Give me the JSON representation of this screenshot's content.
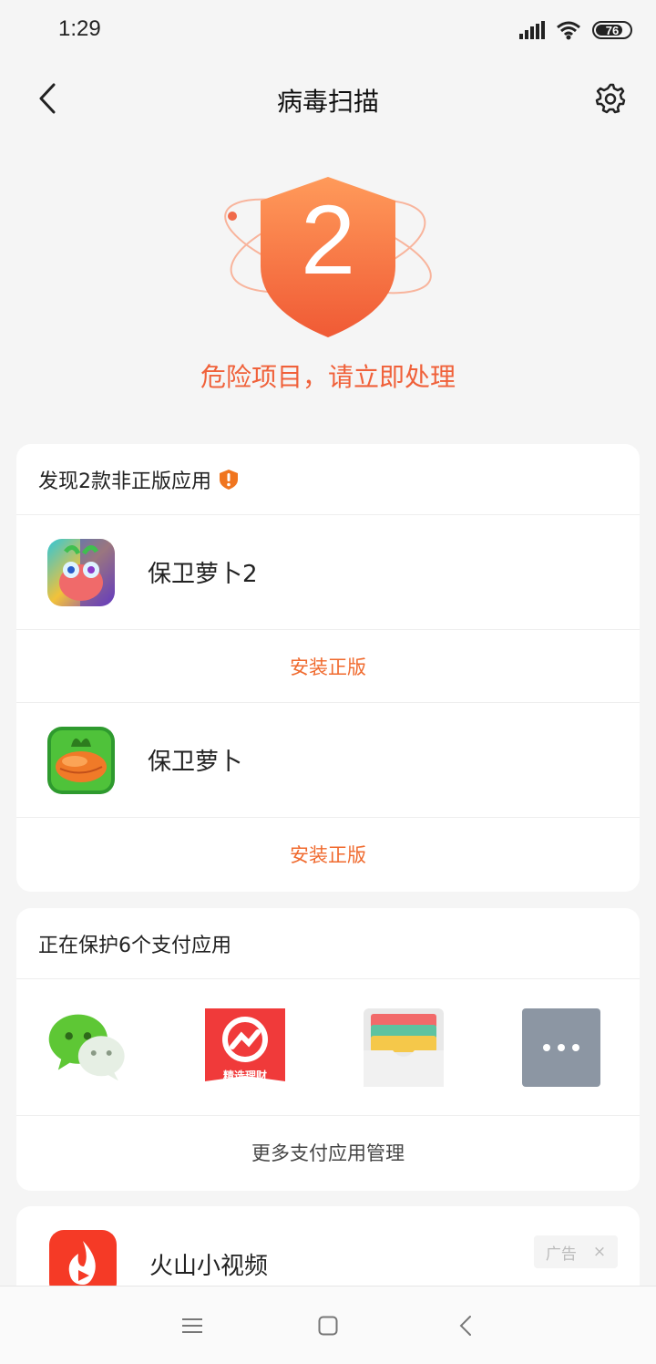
{
  "status_bar": {
    "time": "1:29",
    "battery": "76"
  },
  "header": {
    "title": "病毒扫描"
  },
  "hero": {
    "count": "2",
    "message": "危险项目，请立即处理"
  },
  "pirated_card": {
    "title": "发现2款非正版应用",
    "apps": [
      {
        "name": "保卫萝卜2",
        "action": "安装正版"
      },
      {
        "name": "保卫萝卜",
        "action": "安装正版"
      }
    ]
  },
  "payment_card": {
    "title": "正在保护6个支付应用",
    "icons": [
      "wechat-icon",
      "finance-app-icon",
      "wallet-icon",
      "more-icon"
    ],
    "finance_icon_text": "精选理财",
    "manage_label": "更多支付应用管理"
  },
  "ad_card": {
    "app_name": "火山小视频",
    "ad_label": "广告",
    "close_glyph": "×"
  },
  "colors": {
    "accent": "#f06a2e",
    "danger": "#f0613a",
    "background": "#f5f5f5"
  }
}
